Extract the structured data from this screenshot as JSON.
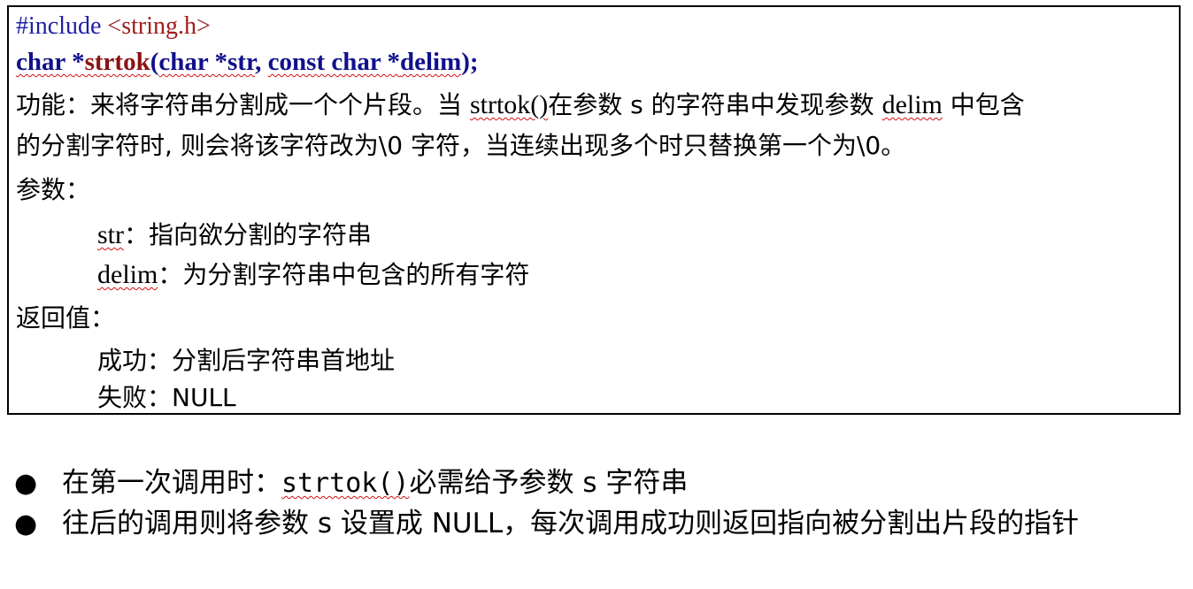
{
  "header": {
    "include_directive": "#include ",
    "include_file": "<string.h>"
  },
  "prototype": {
    "return_type": "char *",
    "function_name": "strtok",
    "open_paren": "(",
    "param1_type": "char *",
    "param1_name": "str",
    "comma": ", ",
    "param2_type": "const char *",
    "param2_name": "delim",
    "close": ");"
  },
  "description": {
    "label": "功能",
    "colon": "：",
    "line1_a": "来将字符串分割成一个个片段。当 ",
    "line1_fn": "strtok()",
    "line1_b": "在参数 s 的字符串中发现参数 ",
    "line1_delim": "delim",
    "line1_c": " 中包含",
    "line2": "的分割字符时, 则会将该字符改为\\0 字符，当连续出现多个时只替换第一个为\\0。"
  },
  "params": {
    "label": "参数：",
    "items": [
      {
        "name": "str",
        "desc": "：指向欲分割的字符串"
      },
      {
        "name": "delim",
        "desc": "：为分割字符串中包含的所有字符"
      }
    ]
  },
  "returns": {
    "label": "返回值：",
    "items": [
      {
        "name": "成功",
        "desc": "：分割后字符串首地址"
      },
      {
        "name": "失败",
        "desc": "：NULL"
      }
    ]
  },
  "bullets": [
    {
      "marker": "●",
      "text_a": "在第一次调用时：",
      "code": "strtok()",
      "text_b": "必需给予参数 s 字符串"
    },
    {
      "marker": "●",
      "text": "往后的调用则将参数 s 设置成 NULL，每次调用成功则返回指向被分割出片段的指针"
    }
  ]
}
